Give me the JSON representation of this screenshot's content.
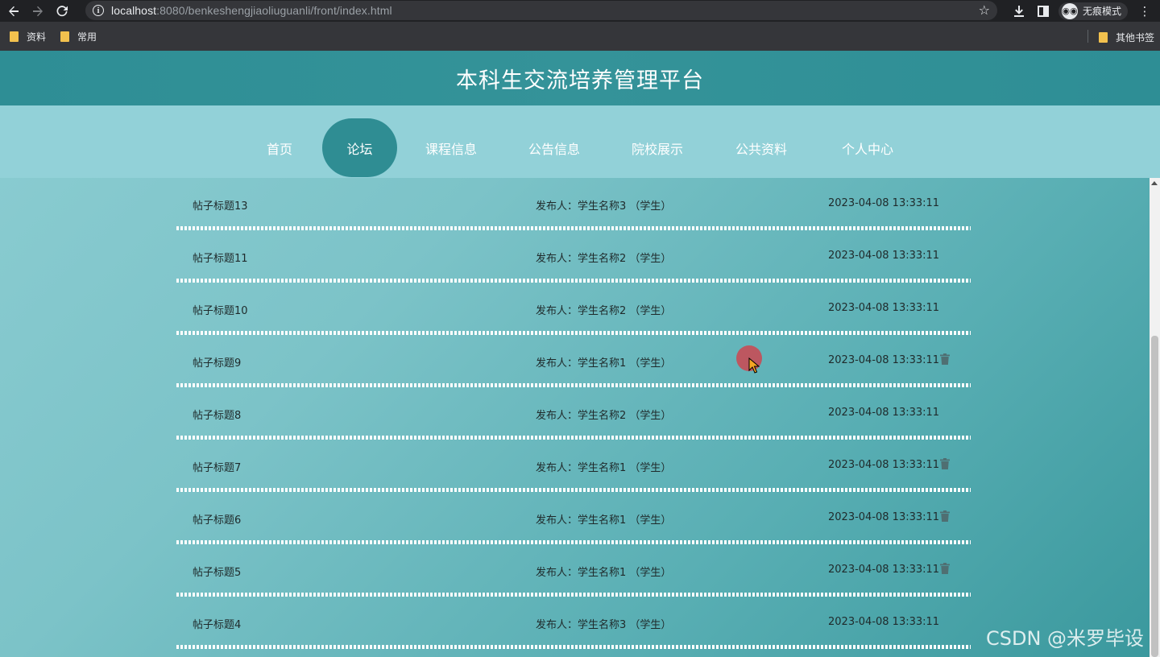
{
  "browser": {
    "url_host": "localhost",
    "url_rest": ":8080/benkeshengjiaoliuguanli/front/index.html",
    "incognito_label": "无痕模式",
    "bookmarks": [
      "资料",
      "常用"
    ],
    "other_bookmarks": "其他书签"
  },
  "site": {
    "title": "本科生交流培养管理平台"
  },
  "nav": {
    "active": "论坛",
    "items": [
      "首页",
      "论坛",
      "课程信息",
      "公告信息",
      "院校展示",
      "公共资料",
      "个人中心"
    ]
  },
  "posts": [
    {
      "title": "帖子标题13",
      "author": "发布人：学生名称3 （学生）",
      "time": "2023-04-08 13:33:11",
      "deletable": false
    },
    {
      "title": "帖子标题11",
      "author": "发布人：学生名称2 （学生）",
      "time": "2023-04-08 13:33:11",
      "deletable": false
    },
    {
      "title": "帖子标题10",
      "author": "发布人：学生名称2 （学生）",
      "time": "2023-04-08 13:33:11",
      "deletable": false
    },
    {
      "title": "帖子标题9",
      "author": "发布人：学生名称1 （学生）",
      "time": "2023-04-08 13:33:11",
      "deletable": true
    },
    {
      "title": "帖子标题8",
      "author": "发布人：学生名称2 （学生）",
      "time": "2023-04-08 13:33:11",
      "deletable": false
    },
    {
      "title": "帖子标题7",
      "author": "发布人：学生名称1 （学生）",
      "time": "2023-04-08 13:33:11",
      "deletable": true
    },
    {
      "title": "帖子标题6",
      "author": "发布人：学生名称1 （学生）",
      "time": "2023-04-08 13:33:11",
      "deletable": true
    },
    {
      "title": "帖子标题5",
      "author": "发布人：学生名称1 （学生）",
      "time": "2023-04-08 13:33:11",
      "deletable": true
    },
    {
      "title": "帖子标题4",
      "author": "发布人：学生名称3 （学生）",
      "time": "2023-04-08 13:33:11",
      "deletable": false
    }
  ],
  "watermark": "CSDN @米罗毕设",
  "colors": {
    "header_bg": "#2e8e95",
    "nav_bg": "#92d1d8",
    "nav_active_bg": "#2f8d93",
    "separator": "#ffffff"
  },
  "icons": {
    "delete": "trash-icon",
    "back": "arrow-left-icon",
    "forward": "arrow-right-icon",
    "reload": "reload-icon"
  }
}
